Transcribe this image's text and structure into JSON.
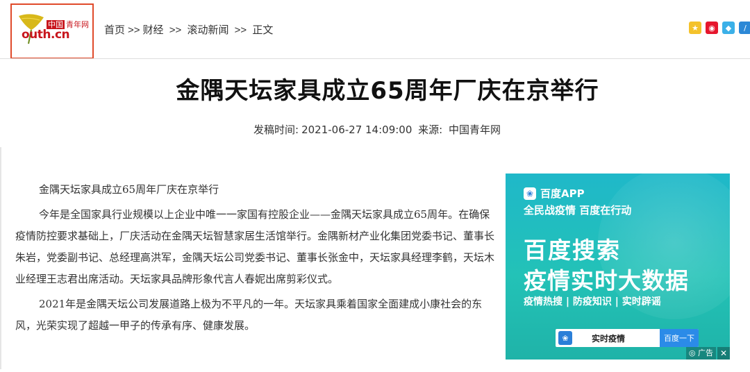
{
  "logo": {
    "tag_red": "中国",
    "tag_name": "青年网",
    "text": "outh.cn",
    "mark": "Y"
  },
  "breadcrumb": {
    "items": [
      "首页",
      ">>",
      "财经",
      ">>",
      "滚动新闻",
      ">>",
      "正文"
    ]
  },
  "share": {
    "icons": [
      "qzone-icon",
      "weibo-icon",
      "qq-icon",
      "more-share-icon"
    ]
  },
  "article": {
    "title": "金隅天坛家具成立65周年厂庆在京举行",
    "meta_label": "发稿时间:",
    "datetime": "2021-06-27 14:09:00",
    "source_label": "来源:",
    "source": "中国青年网",
    "paragraphs": [
      "金隅天坛家具成立65周年厂庆在京举行",
      "今年是全国家具行业规模以上企业中唯一一家国有控股企业——金隅天坛家具成立65周年。在确保疫情防控要求基础上，厂庆活动在金隅天坛智慧家居生活馆举行。金隅新材产业化集团党委书记、董事长朱岩，党委副书记、总经理高洪军，金隅天坛公司党委书记、董事长张金中，天坛家具经理李鹤，天坛木业经理王志君出席活动。天坛家具品牌形象代言人春妮出席剪彩仪式。",
      "2021年是金隅天坛公司发展道路上极为不平凡的一年。天坛家具乘着国家全面建成小康社会的东风，光荣实现了超越一甲子的传承有序、健康发展。"
    ]
  },
  "ad": {
    "app_name": "百度APP",
    "slogan": "全民战疫情 百度在行动",
    "headline1": "百度搜索",
    "headline2": "疫情实时大数据",
    "tags": "疫情热搜 | 防疫知识 | 实时辟谣",
    "search_text": "实时疫情",
    "search_button": "百度一下",
    "ad_label": "广告",
    "close": "✕",
    "bg_color": "#22bdb8"
  }
}
